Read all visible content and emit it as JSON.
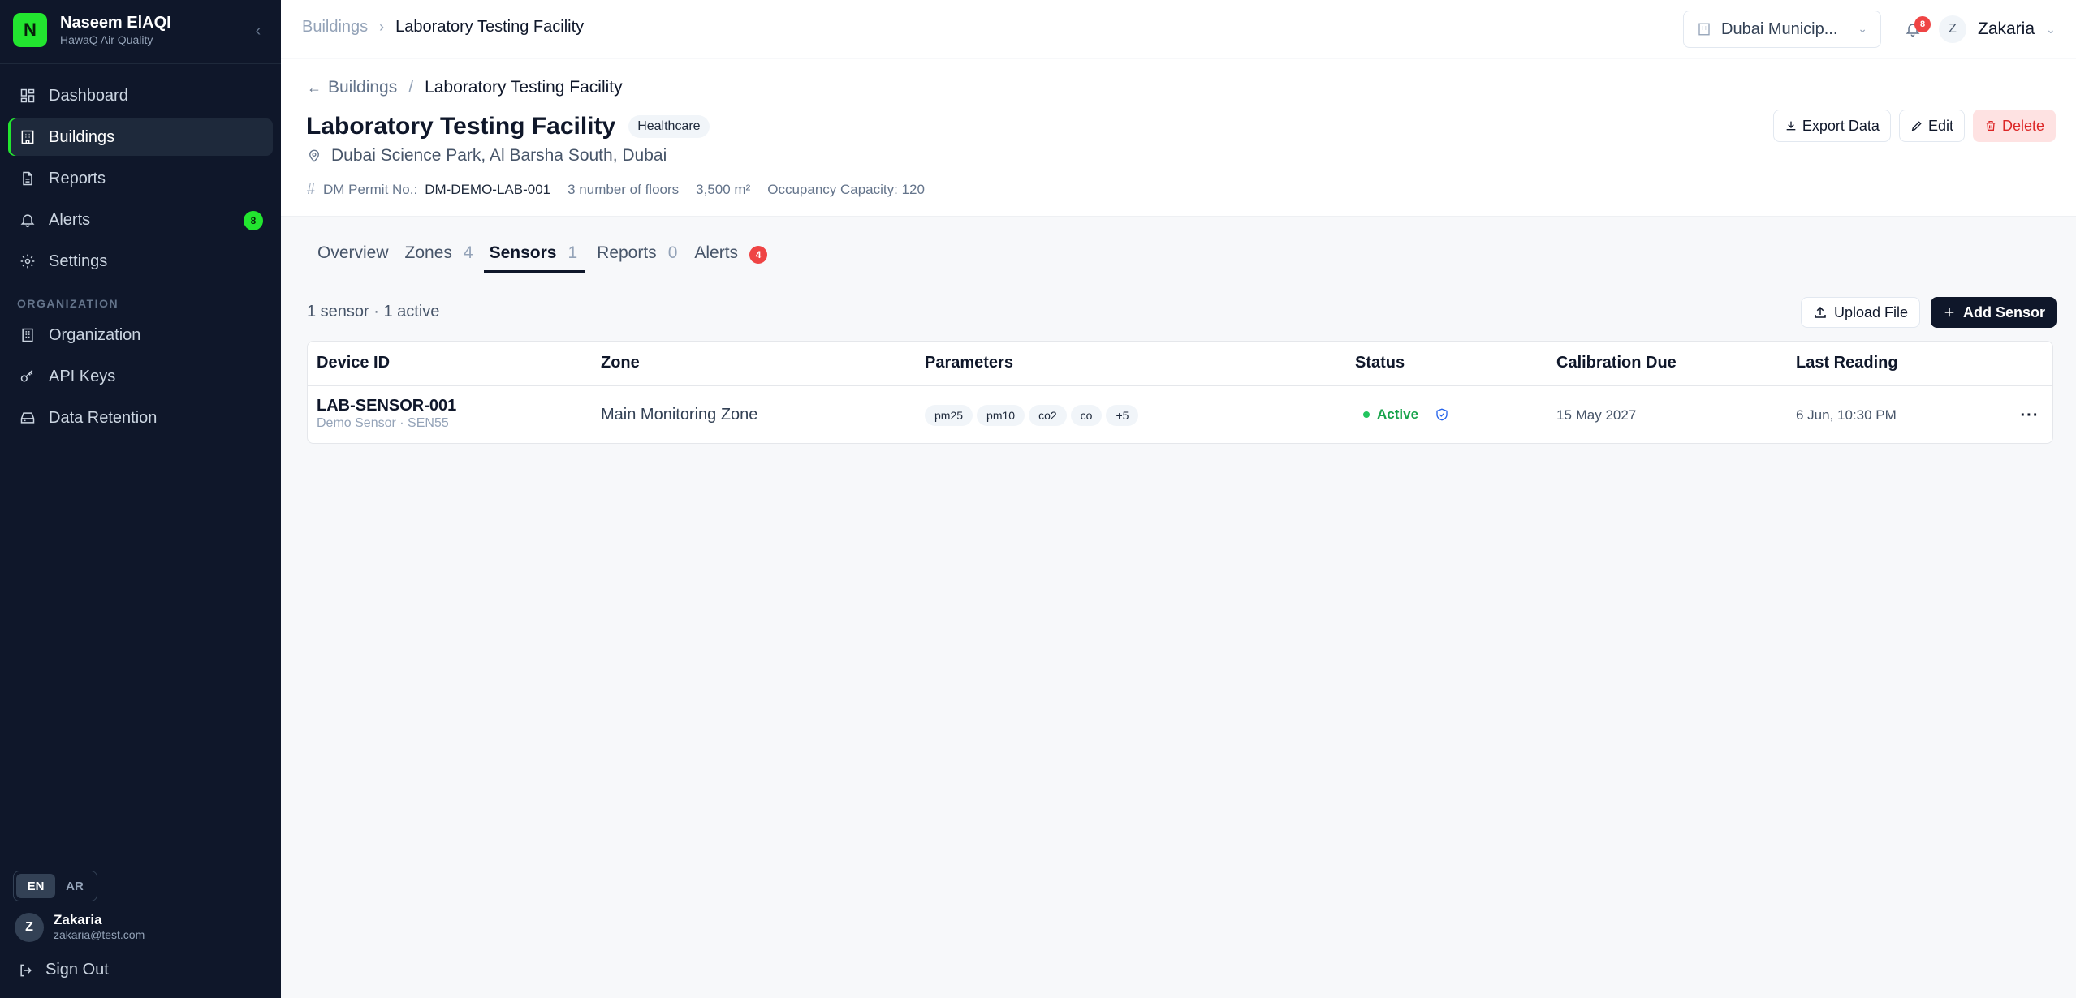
{
  "brand": {
    "initial": "N",
    "name": "Naseem ElAQI",
    "subtitle": "HawaQ Air Quality"
  },
  "sidebar": {
    "items": [
      {
        "label": "Dashboard",
        "icon": "dashboard-icon"
      },
      {
        "label": "Buildings",
        "icon": "building-icon",
        "active": true
      },
      {
        "label": "Reports",
        "icon": "file-icon"
      },
      {
        "label": "Alerts",
        "icon": "bell-icon",
        "badge": "8"
      },
      {
        "label": "Settings",
        "icon": "gear-icon"
      }
    ],
    "section_label": "ORGANIZATION",
    "org_items": [
      {
        "label": "Organization",
        "icon": "organization-icon"
      },
      {
        "label": "API Keys",
        "icon": "key-icon"
      },
      {
        "label": "Data Retention",
        "icon": "storage-icon"
      }
    ],
    "lang": {
      "en": "EN",
      "ar": "AR"
    },
    "user": {
      "initial": "Z",
      "name": "Zakaria",
      "email": "zakaria@test.com"
    },
    "signout_label": "Sign Out"
  },
  "topbar": {
    "breadcrumb_root": "Buildings",
    "breadcrumb_current": "Laboratory Testing Facility",
    "org_select_value": "Dubai Municip...",
    "notifications_count": "8",
    "user_initial": "Z",
    "user_name": "Zakaria"
  },
  "page": {
    "back_crumb": "Buildings",
    "crumb_sep": "/",
    "crumb_current": "Laboratory Testing Facility",
    "title": "Laboratory Testing Facility",
    "category": "Healthcare",
    "address": "Dubai Science Park, Al Barsha South, Dubai",
    "permit_label": "DM Permit No.:",
    "permit_value": "DM-DEMO-LAB-001",
    "floors": "3 number of floors",
    "area": "3,500 m²",
    "occupancy": "Occupancy Capacity: 120",
    "actions": {
      "export": "Export Data",
      "edit": "Edit",
      "delete": "Delete"
    }
  },
  "tabs": [
    {
      "label": "Overview",
      "count": ""
    },
    {
      "label": "Zones",
      "count": "4"
    },
    {
      "label": "Sensors",
      "count": "1",
      "active": true
    },
    {
      "label": "Reports",
      "count": "0"
    },
    {
      "label": "Alerts",
      "badge": "4"
    }
  ],
  "sensors": {
    "summary": "1 sensor · 1 active",
    "upload_label": "Upload File",
    "add_label": "Add Sensor",
    "columns": [
      "Device ID",
      "Zone",
      "Parameters",
      "Status",
      "Calibration Due",
      "Last Reading"
    ],
    "rows": [
      {
        "device_id": "LAB-SENSOR-001",
        "device_sub": "Demo Sensor · SEN55",
        "zone": "Main Monitoring Zone",
        "parameters": [
          "pm25",
          "pm10",
          "co2",
          "co",
          "+5"
        ],
        "status": "Active",
        "calibration_due": "15 May 2027",
        "last_reading": "6 Jun, 10:30 PM",
        "more": "···"
      }
    ]
  },
  "colors": {
    "sidebar_bg": "#0f172a",
    "brand_accent": "#22e62f",
    "danger": "#ef4444",
    "status_active": "#16a34a"
  }
}
